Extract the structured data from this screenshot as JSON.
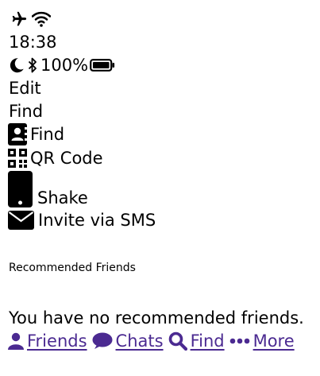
{
  "status_bar": {
    "time": "18:38",
    "battery": "100%",
    "icons": [
      "airplane-icon",
      "wifi-icon",
      "moon-icon",
      "bluetooth-icon",
      "battery-icon"
    ]
  },
  "toolbar": {
    "edit_label": "Edit"
  },
  "find_section": {
    "title": "Find",
    "items": [
      {
        "label": "Find",
        "icon": "contact-card-icon"
      },
      {
        "label": "QR Code",
        "icon": "qr-code-icon"
      },
      {
        "label": "Shake",
        "icon": "phone-icon"
      },
      {
        "label": "Invite via SMS",
        "icon": "envelope-icon"
      }
    ]
  },
  "recommended": {
    "title": "Recommended Friends",
    "empty_message": "You have no recommended friends."
  },
  "tab_bar": {
    "tabs": [
      {
        "label": "Friends",
        "icon": "user-icon"
      },
      {
        "label": "Chats",
        "icon": "chat-bubble-icon"
      },
      {
        "label": "Find",
        "icon": "search-icon"
      },
      {
        "label": "More",
        "icon": "more-dots-icon"
      }
    ]
  },
  "colors": {
    "accent": "#4b2a91",
    "text": "#000000",
    "background": "#ffffff"
  }
}
